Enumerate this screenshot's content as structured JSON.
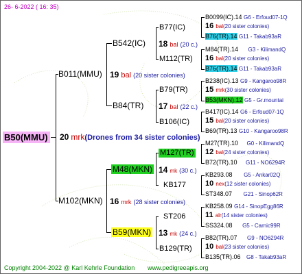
{
  "header_date": "26-  6-2022  ( 16:  35)",
  "footer_copyright": "Copyright 2004-2022 @ Karl Kehrle Foundation",
  "footer_url": "www.pedigreeapis.org",
  "root": {
    "id": "B50(MMU)"
  },
  "gen1": {
    "drones_num": "20",
    "drones_mark": "mrk",
    "drones_text": "(Drones from 34 sister colonies)",
    "upper": {
      "id": "B011(MMU)",
      "num": "19",
      "mark": "bal",
      "note": "(20 sister colonies)"
    },
    "lower": {
      "id": "M102(MKN)",
      "num": "16",
      "mark": "mrk",
      "note": "(28 sister colonies)"
    }
  },
  "gen2": {
    "b542": {
      "id": "B542(IC)",
      "num": "18",
      "mark": "bal",
      "note": "(20 c.)"
    },
    "b84": {
      "id": "B84(TR)",
      "num": "17",
      "mark": "bal",
      "note": "(22 c.)"
    },
    "m48": {
      "id": "M48(MKN)",
      "num": "14",
      "mark": "mk",
      "note": "(30 c.)"
    },
    "b59": {
      "id": "B59(MKN)",
      "num": "13",
      "mark": "mk",
      "note": "(24 c.)"
    }
  },
  "gen3": {
    "b77": {
      "id": "B77(IC)"
    },
    "m112": {
      "id": "M112(TR)"
    },
    "b79": {
      "id": "B79(TR)"
    },
    "b106": {
      "id": "B106(IC)"
    },
    "m127": {
      "id": "M127(TR)",
      "num": "12",
      "mark": "bal",
      "note": "(24 sister colonies)"
    },
    "kb177": {
      "id": "KB177"
    },
    "st206": {
      "id": "ST206"
    },
    "b129": {
      "id": "B129(TR)"
    }
  },
  "gen4": [
    {
      "id": "B0099(IC).14",
      "info": "G6 - Erfoud07-1Q"
    },
    {
      "num": "16",
      "mark": "bal",
      "note": "(20 sister colonies)"
    },
    {
      "id": "B76(TR).14",
      "info": "G11 - Takab93aR"
    },
    {
      "id": "M84(TR).14",
      "info": "G3 - KilimandQ"
    },
    {
      "num": "16",
      "mark": "bal",
      "note": "(20 sister colonies)"
    },
    {
      "id": "B76(TR).14",
      "info": "G11 - Takab93aR"
    },
    {
      "id": "B238(IC).13",
      "info": "G9 - Kangaroo98R"
    },
    {
      "num": "15",
      "mark": "mrk",
      "note": "(30 sister colonies)"
    },
    {
      "id": "B53(MKN).12",
      "info": "G5 - Gr.mountai"
    },
    {
      "id": "B417(IC).14",
      "info": "G6 - Erfoud07-1Q"
    },
    {
      "num": "15",
      "mark": "bal",
      "note": "(20 sister colonies)"
    },
    {
      "id": "B69(TR).13",
      "info": "G10 - Kangaroo98R"
    },
    {
      "id": "M27(TR).10",
      "info": "G0 - KilimandQ"
    },
    {
      "id": "B72(TR).10",
      "info": "G11 - NO6294R"
    },
    {
      "id": "KB293.08",
      "info": "G5 - Ankar02Q"
    },
    {
      "num": "10",
      "mark": "nex",
      "note": "(12 sister colonies)"
    },
    {
      "id": "ST348.07",
      "info": "G21 - Sinop62R"
    },
    {
      "id": "KB258.09",
      "info": "G14 - SinopEgg86R"
    },
    {
      "num": "11",
      "mark": "alr",
      "note": "(14 sister colonies)"
    },
    {
      "id": "SS324.08",
      "info": "G5 - Carnic99R"
    },
    {
      "id": "B82(TR).07",
      "info": "G9 - NO6294R"
    },
    {
      "num": "10",
      "mark": "bal",
      "note": "(23 sister colonies)"
    },
    {
      "id": "B135(TR).06",
      "info": "G8 - Takab93aR"
    }
  ]
}
